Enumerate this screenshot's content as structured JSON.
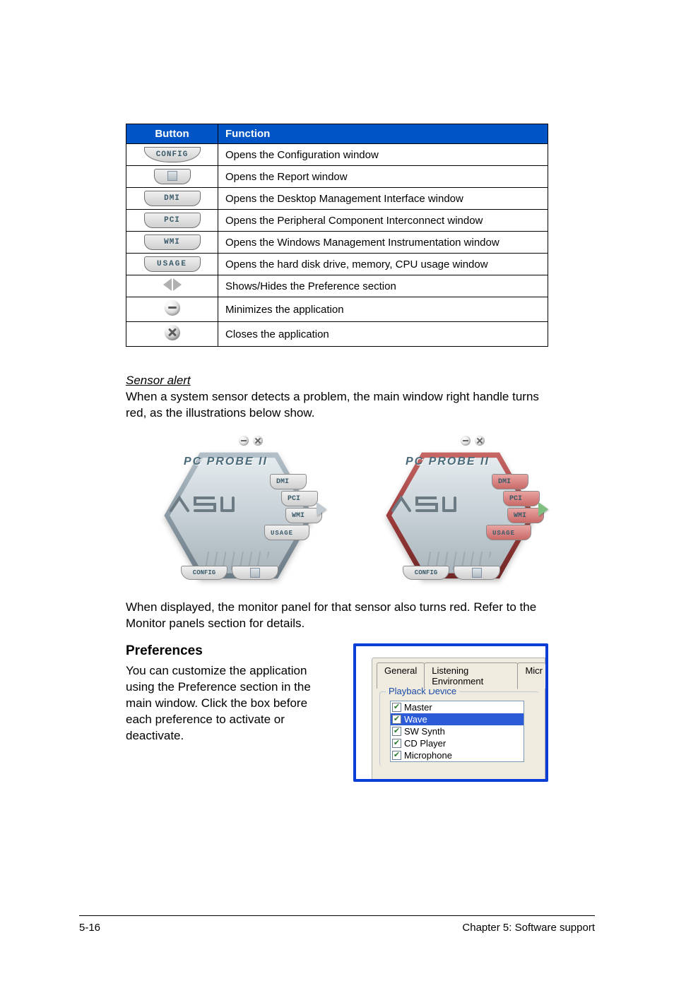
{
  "table": {
    "headers": {
      "button": "Button",
      "function": "Function"
    },
    "rows": [
      {
        "icon_label": "CONFIG",
        "desc": "Opens the Configuration window"
      },
      {
        "icon_label": "",
        "desc": "Opens the Report window"
      },
      {
        "icon_label": "DMI",
        "desc": "Opens the Desktop Management Interface window"
      },
      {
        "icon_label": "PCI",
        "desc": "Opens the Peripheral Component Interconnect window"
      },
      {
        "icon_label": "WMI",
        "desc": "Opens the Windows Management Instrumentation window"
      },
      {
        "icon_label": "USAGE",
        "desc": "Opens the hard disk drive, memory, CPU usage window"
      },
      {
        "icon_label": "",
        "desc": "Shows/Hides the Preference section"
      },
      {
        "icon_label": "",
        "desc": "Minimizes the application"
      },
      {
        "icon_label": "",
        "desc": "Closes the application"
      }
    ]
  },
  "sensor": {
    "heading": "Sensor alert",
    "text": "When a system sensor detects a problem, the main window right handle turns red, as the illustrations below show.",
    "brand": "PC PROBE II",
    "tabs": {
      "dmi": "DMI",
      "pci": "PCI",
      "wmi": "WMI",
      "usage": "USAGE",
      "config": "CONFIG"
    },
    "after_text": "When displayed, the monitor panel for that sensor also turns red. Refer to the Monitor panels section for details."
  },
  "prefs": {
    "heading": "Preferences",
    "text": "You can customize the application using the Preference section in the main window. Click the box before each preference to activate or deactivate.",
    "tabs": {
      "general": "General",
      "listening": "Listening Environment",
      "mic": "Micr"
    },
    "group_label": "Playback Device",
    "items": {
      "master": "Master",
      "wave": "Wave",
      "swsynth": "SW Synth",
      "cdplayer": "CD Player",
      "microphone": "Microphone"
    }
  },
  "footer": {
    "left": "5-16",
    "right": "Chapter 5: Software support"
  }
}
